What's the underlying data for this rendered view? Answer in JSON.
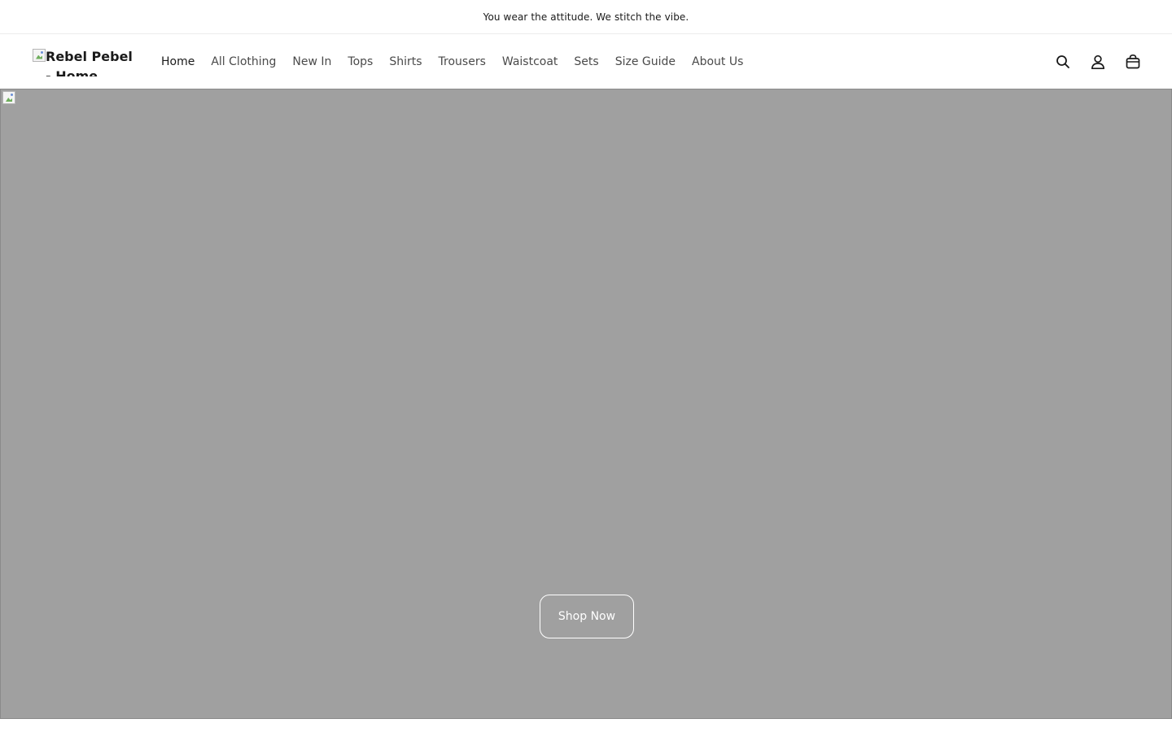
{
  "announcement": {
    "text": "You wear the attitude. We stitch the vibe."
  },
  "header": {
    "logo_alt": "Rebel Pebel - Home",
    "nav": [
      {
        "label": "Home",
        "active": true
      },
      {
        "label": "All Clothing"
      },
      {
        "label": "New In"
      },
      {
        "label": "Tops"
      },
      {
        "label": "Shirts"
      },
      {
        "label": "Trousers"
      },
      {
        "label": "Waistcoat"
      },
      {
        "label": "Sets"
      },
      {
        "label": "Size Guide"
      },
      {
        "label": "About Us"
      }
    ],
    "icons": [
      "search-icon",
      "account-icon",
      "cart-icon"
    ]
  },
  "hero": {
    "background_color": "#a0a0a0",
    "cta_label": "Shop Now"
  }
}
